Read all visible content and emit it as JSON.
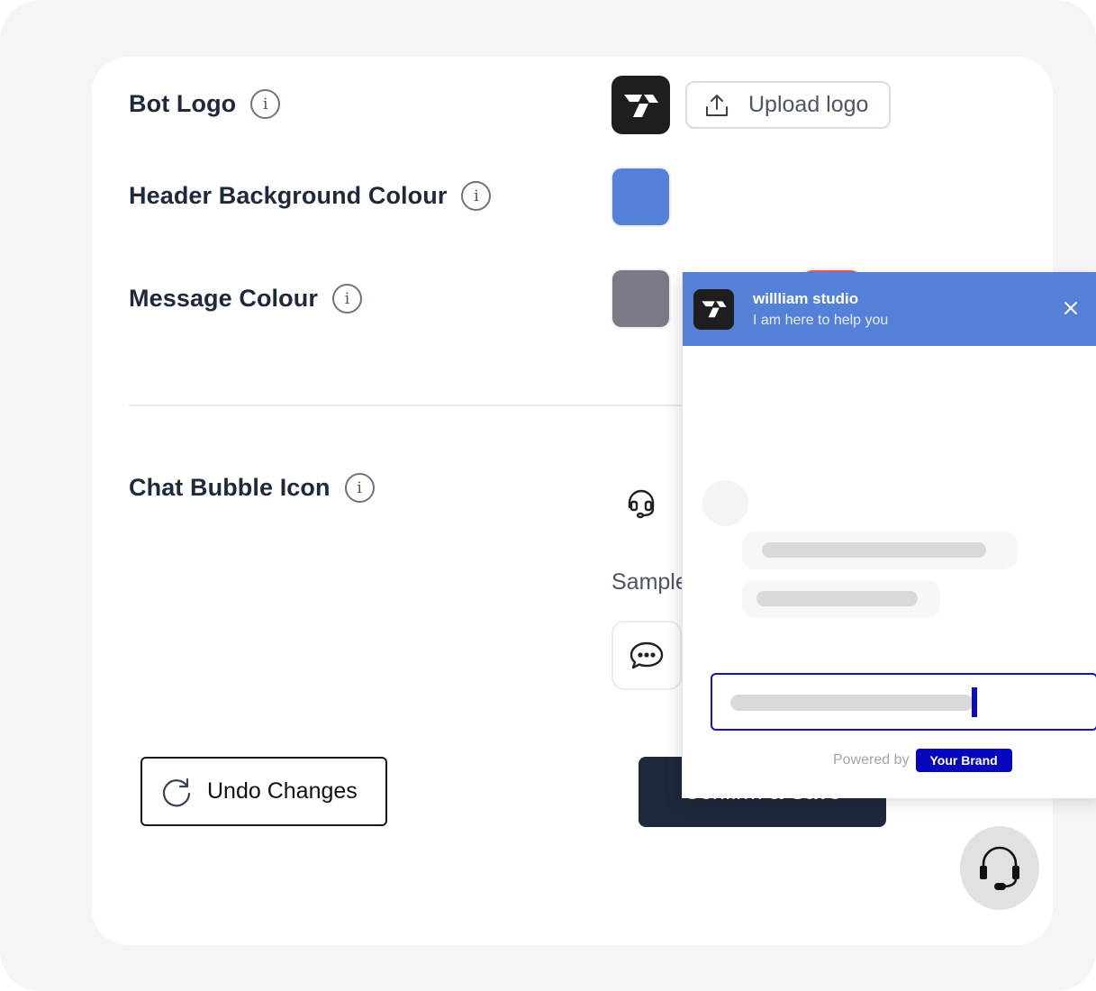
{
  "settings": {
    "bot_logo": {
      "label": "Bot Logo",
      "upload_label": "Upload logo"
    },
    "header_bg": {
      "label": "Header Background Colour",
      "color": "#5480d8"
    },
    "message_colour": {
      "label": "Message Colour",
      "colors": [
        "#7a7a85",
        "#d85c62"
      ]
    },
    "chat_bubble": {
      "label": "Chat Bubble Icon",
      "sample_label": "Sample"
    }
  },
  "buttons": {
    "undo": "Undo Changes",
    "confirm": "Confirm & Save"
  },
  "chat_preview": {
    "name": "willliam studio",
    "subtitle": "I am here to help you",
    "powered_by": "Powered by",
    "brand": "Your Brand",
    "accent": "#0606bd"
  },
  "icons": {
    "info": "i"
  }
}
